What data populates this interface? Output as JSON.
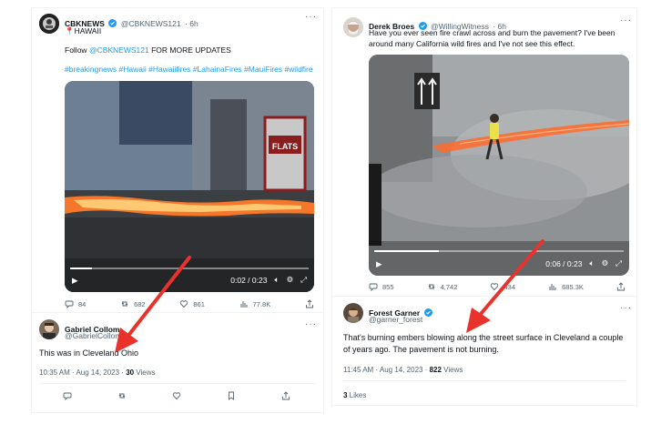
{
  "left_tweet": {
    "author_name": "CBKNEWS",
    "handle": "@CBKNEWS121",
    "time": "· 6h",
    "line1": "HAWAII",
    "follow_prefix": "Follow ",
    "follow_handle": "@CBKNEWS121",
    "follow_suffix": " FOR MORE UPDATES",
    "hashtags": "#breakingnews #Hawaii #Hawaiifires #LahainaFires #MauiFires #wildfire",
    "video_sign": "FLATS",
    "video_time": "0:02 / 0:23",
    "video_progress": 0.09,
    "replies": "84",
    "reposts": "682",
    "likes": "861",
    "views": "77.8K"
  },
  "left_reply": {
    "author_name": "Gabriel Collom",
    "handle": "@GabrielCollom",
    "text": "This was in Cleveland Ohio",
    "timestamp": "10:35 AM · Aug 14, 2023 · ",
    "views_count": "30",
    "views_label": " Views"
  },
  "right_tweet": {
    "author_name": "Derek Broes",
    "handle": "@WillingWitness",
    "time": "· 6h",
    "text": "Have you ever seen fire crawl across and burn the pavement? I've been around many California wild fires and I've not see this effect.",
    "video_time": "0:06 / 0:23",
    "video_progress": 0.26,
    "replies": "855",
    "reposts": "4,742",
    "likes": "434",
    "views": "685.3K"
  },
  "right_reply": {
    "author_name": "Forest Garner",
    "handle": "@garner_forest",
    "text": "That's burning embers blowing along the street surface in Cleveland a couple of years ago.  The pavement is not burning.",
    "timestamp": "11:45 AM · Aug 14, 2023 · ",
    "views_count": "822",
    "views_label": " Views",
    "likes_count": "3",
    "likes_label": " Likes"
  },
  "colors": {
    "link": "#1d9bf0",
    "verified": "#1d9bf0",
    "arrow": "#e8322b",
    "muted": "#536471"
  }
}
